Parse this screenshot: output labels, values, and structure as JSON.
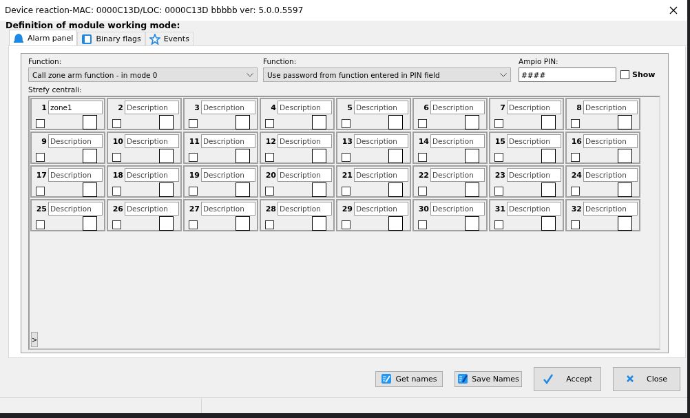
{
  "window": {
    "title": "Device reaction-MAC: 0000C13D/LOC: 0000C13D bbbbb ver: 5.0.0.5597"
  },
  "heading": "Definition of module working mode:",
  "tabs": [
    {
      "label": "Alarm panel",
      "kind": "bell",
      "selected": true
    },
    {
      "label": "Binary flags",
      "kind": "flag",
      "selected": false
    },
    {
      "label": "Events",
      "kind": "star",
      "selected": false
    }
  ],
  "function_1": {
    "label": "Function:",
    "value": "Call zone arm function - in mode 0"
  },
  "function_2": {
    "label": "Function:",
    "value": "Use password from function entered in PIN field"
  },
  "pin": {
    "label": "Ampio PIN:",
    "value": "####",
    "show_label": "Show",
    "show_checked": false
  },
  "zones_label": "Strefy centrali:",
  "zones": [
    {
      "number": "1",
      "value": "zone1",
      "checked": false
    },
    {
      "number": "2",
      "placeholder": "Description",
      "checked": false
    },
    {
      "number": "3",
      "placeholder": "Description",
      "checked": false
    },
    {
      "number": "4",
      "placeholder": "Description",
      "checked": false
    },
    {
      "number": "5",
      "placeholder": "Description",
      "checked": false
    },
    {
      "number": "6",
      "placeholder": "Description",
      "checked": false
    },
    {
      "number": "7",
      "placeholder": "Description",
      "checked": false
    },
    {
      "number": "8",
      "placeholder": "Description",
      "checked": false
    },
    {
      "number": "9",
      "placeholder": "Description",
      "checked": false
    },
    {
      "number": "10",
      "placeholder": "Description",
      "checked": false
    },
    {
      "number": "11",
      "placeholder": "Description",
      "checked": false
    },
    {
      "number": "12",
      "placeholder": "Description",
      "checked": false
    },
    {
      "number": "13",
      "placeholder": "Description",
      "checked": false
    },
    {
      "number": "14",
      "placeholder": "Description",
      "checked": false
    },
    {
      "number": "15",
      "placeholder": "Description",
      "checked": false
    },
    {
      "number": "16",
      "placeholder": "Description",
      "checked": false
    },
    {
      "number": "17",
      "placeholder": "Description",
      "checked": false
    },
    {
      "number": "18",
      "placeholder": "Description",
      "checked": false
    },
    {
      "number": "19",
      "placeholder": "Description",
      "checked": false
    },
    {
      "number": "20",
      "placeholder": "Description",
      "checked": false
    },
    {
      "number": "21",
      "placeholder": "Description",
      "checked": false
    },
    {
      "number": "22",
      "placeholder": "Description",
      "checked": false
    },
    {
      "number": "23",
      "placeholder": "Description",
      "checked": false
    },
    {
      "number": "24",
      "placeholder": "Description",
      "checked": false
    },
    {
      "number": "25",
      "placeholder": "Description",
      "checked": false
    },
    {
      "number": "26",
      "placeholder": "Description",
      "checked": false
    },
    {
      "number": "27",
      "placeholder": "Description",
      "checked": false
    },
    {
      "number": "28",
      "placeholder": "Description",
      "checked": false
    },
    {
      "number": "29",
      "placeholder": "Description",
      "checked": false
    },
    {
      "number": "30",
      "placeholder": "Description",
      "checked": false
    },
    {
      "number": "31",
      "placeholder": "Description",
      "checked": false
    },
    {
      "number": "32",
      "placeholder": "Description",
      "checked": false
    }
  ],
  "expand_button": ">",
  "buttons": [
    {
      "label": "Get names",
      "kind": "get"
    },
    {
      "label": "Save Names",
      "kind": "save"
    },
    {
      "label": "Accept",
      "kind": "accept"
    },
    {
      "label": "Close",
      "kind": "close"
    }
  ]
}
